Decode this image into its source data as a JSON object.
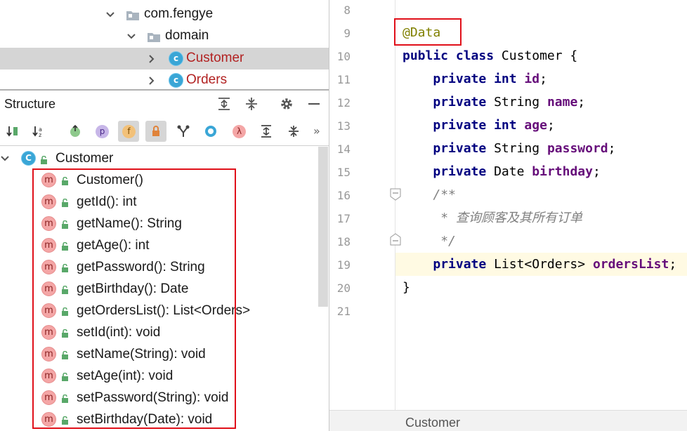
{
  "project_tree": {
    "items": [
      {
        "label": "com.fengye",
        "kind": "package",
        "expanded": true
      },
      {
        "label": "domain",
        "kind": "package",
        "expanded": true
      },
      {
        "label": "Customer",
        "kind": "class",
        "selected": true
      },
      {
        "label": "Orders",
        "kind": "class"
      }
    ]
  },
  "structure": {
    "title": "Structure",
    "root_icon": "C",
    "root_label": "Customer",
    "toolbar": {
      "property_letter": "p",
      "field_letter": "f",
      "lambda_letter": "λ",
      "more": "»"
    },
    "member_icon_letter": "m",
    "members": [
      "Customer()",
      "getId(): int",
      "getName(): String",
      "getAge(): int",
      "getPassword(): String",
      "getBirthday(): Date",
      "getOrdersList(): List<Orders>",
      "setId(int): void",
      "setName(String): void",
      "setAge(int): void",
      "setPassword(String): void",
      "setBirthday(Date): void"
    ]
  },
  "editor": {
    "line_numbers": [
      "8",
      "9",
      "10",
      "11",
      "12",
      "13",
      "14",
      "15",
      "16",
      "17",
      "18",
      "19",
      "20",
      "21"
    ],
    "code": {
      "annotation": "@Data",
      "l10_kw1": "public",
      "l10_kw2": "class",
      "l10_rest": " Customer {",
      "kw_private": "private",
      "kw_int": "int",
      "f_id": "id",
      "t_string": "String",
      "f_name": "name",
      "f_age": "age",
      "f_password": "password",
      "t_date": "Date",
      "f_birthday": "birthday",
      "c_open": "/**",
      "c_body": " * 查询顾客及其所有订单",
      "c_close": " */",
      "t_list": "List<Orders>",
      "f_orderslist": "ordersList",
      "semi": ";",
      "close_brace": "}"
    },
    "highlighted_line": "19",
    "breadcrumb": "Customer"
  },
  "colors": {
    "keyword": "#000080",
    "field": "#660e7a",
    "annotation": "#808000",
    "comment": "#808080",
    "highlight_box": "#e0101a",
    "selection": "#d5d5d5",
    "current_line": "#fffae3"
  }
}
